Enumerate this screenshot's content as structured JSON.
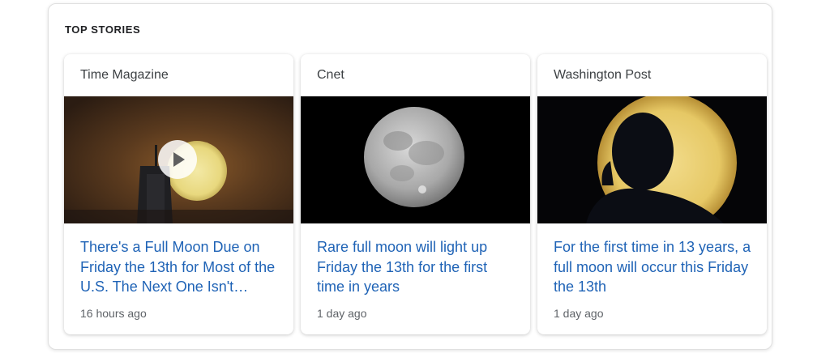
{
  "section": {
    "title": "TOP STORIES"
  },
  "stories": [
    {
      "source": "Time Magazine",
      "headline": "There's a Full Moon Due on Friday the 13th for Most of the U.S. The Next One Isn't…",
      "time": "16 hours ago",
      "thumbnail_icon": "video-thumbnail",
      "has_video": true
    },
    {
      "source": "Cnet",
      "headline": "Rare full moon will light up Friday the 13th for the first time in years",
      "time": "1 day ago",
      "thumbnail_icon": "image-thumbnail"
    },
    {
      "source": "Washington Post",
      "headline": "For the first time in 13 years, a full moon will occur this Friday the 13th",
      "time": "1 day ago",
      "thumbnail_icon": "image-thumbnail"
    }
  ],
  "colors": {
    "headline_link": "#1f63b6",
    "meta_text": "#5f6368"
  }
}
